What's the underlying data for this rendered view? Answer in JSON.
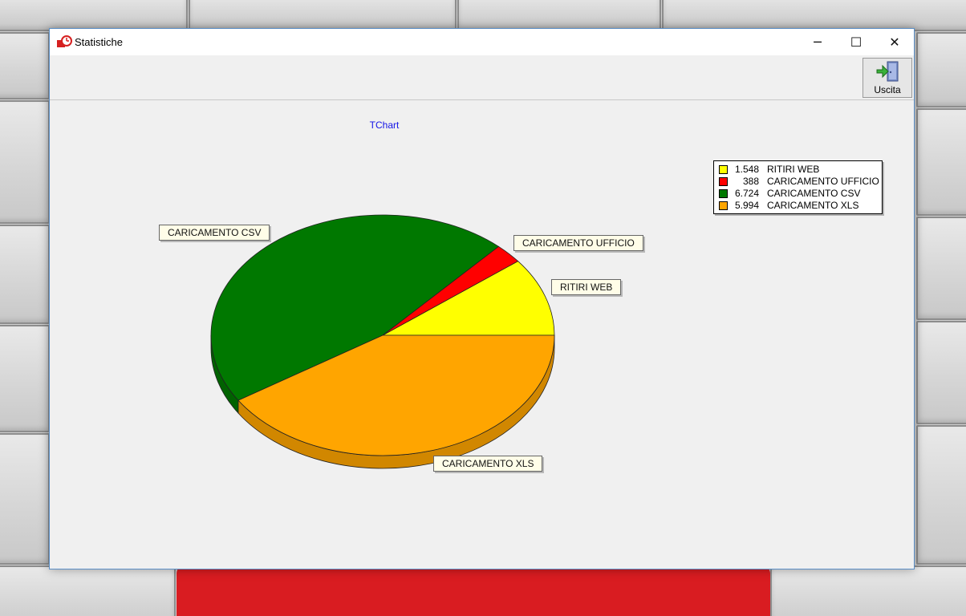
{
  "window": {
    "title": "Statistiche",
    "controls": {
      "minimize": "─",
      "maximize": "☐",
      "close": "✕"
    }
  },
  "toolbar": {
    "exit_label": "Uscita",
    "exit_icon": "exit-door-icon"
  },
  "chart_data": {
    "type": "pie",
    "title": "TChart",
    "three_d": true,
    "legend_position": "top-right",
    "categories": [
      "RITIRI WEB",
      "CARICAMENTO UFFICIO",
      "CARICAMENTO CSV",
      "CARICAMENTO XLS"
    ],
    "values": [
      1548,
      388,
      6724,
      5994
    ],
    "value_labels": [
      "1.548",
      "388",
      "6.724",
      "5.994"
    ],
    "colors": [
      "#ffff00",
      "#ff0000",
      "#007800",
      "#ffa500"
    ]
  }
}
